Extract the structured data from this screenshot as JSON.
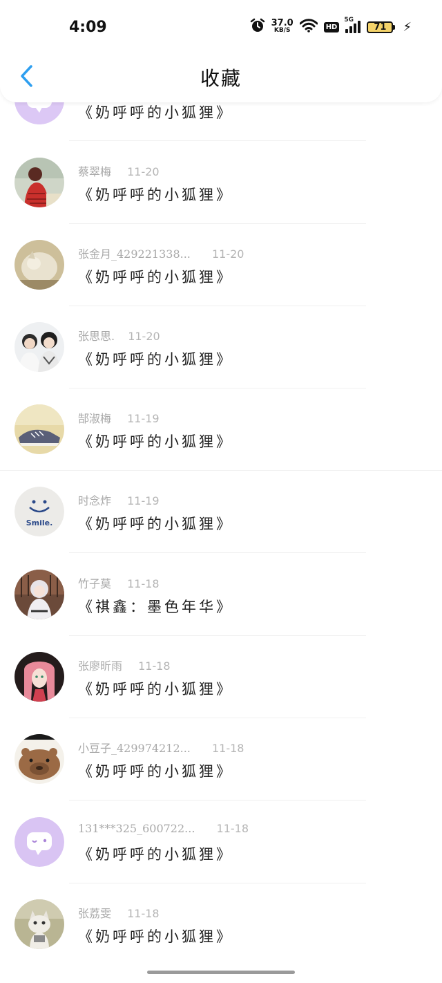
{
  "status_bar": {
    "time": "4:09",
    "speed_value": "37.0",
    "speed_unit": "KB/S",
    "hd": "HD",
    "network": "5G",
    "battery": "71"
  },
  "header": {
    "title": "收藏"
  },
  "items": [
    {
      "name": "",
      "date": "",
      "book": "《奶呼呼的小狐狸》",
      "avatar": "chat-bubble-avatar"
    },
    {
      "name": "蔡翠梅",
      "date": "11-20",
      "book": "《奶呼呼的小狐狸》",
      "avatar": "girl-red-avatar"
    },
    {
      "name": "张金月_429221338...",
      "date": "11-20",
      "book": "《奶呼呼的小狐狸》",
      "avatar": "cat-avatar"
    },
    {
      "name": "张思思.",
      "date": "11-20",
      "book": "《奶呼呼的小狐狸》",
      "avatar": "couple-avatar"
    },
    {
      "name": "郜淑梅",
      "date": "11-19",
      "book": "《奶呼呼的小狐狸》",
      "avatar": "sneakers-avatar"
    },
    {
      "name": "时念炸",
      "date": "11-19",
      "book": "《奶呼呼的小狐狸》",
      "avatar": "smile-avatar"
    },
    {
      "name": "竹子莫",
      "date": "11-18",
      "book": "《祺鑫：墨色年华》",
      "avatar": "anime-girl-avatar"
    },
    {
      "name": "张廖昕雨",
      "date": "11-18",
      "book": "《奶呼呼的小狐狸》",
      "avatar": "pink-hair-avatar"
    },
    {
      "name": "小豆子_429974212...",
      "date": "11-18",
      "book": "《奶呼呼的小狐狸》",
      "avatar": "capybara-avatar"
    },
    {
      "name": "131***325_600722...",
      "date": "11-18",
      "book": "《奶呼呼的小狐狸》",
      "avatar": "chat-bubble-avatar"
    },
    {
      "name": "张荔雯",
      "date": "11-18",
      "book": "《奶呼呼的小狐狸》",
      "avatar": "kitten-avatar"
    }
  ],
  "colors": {
    "accent": "#2e9ff0",
    "name_text": "#a8a8a8",
    "book_text": "#222222"
  }
}
